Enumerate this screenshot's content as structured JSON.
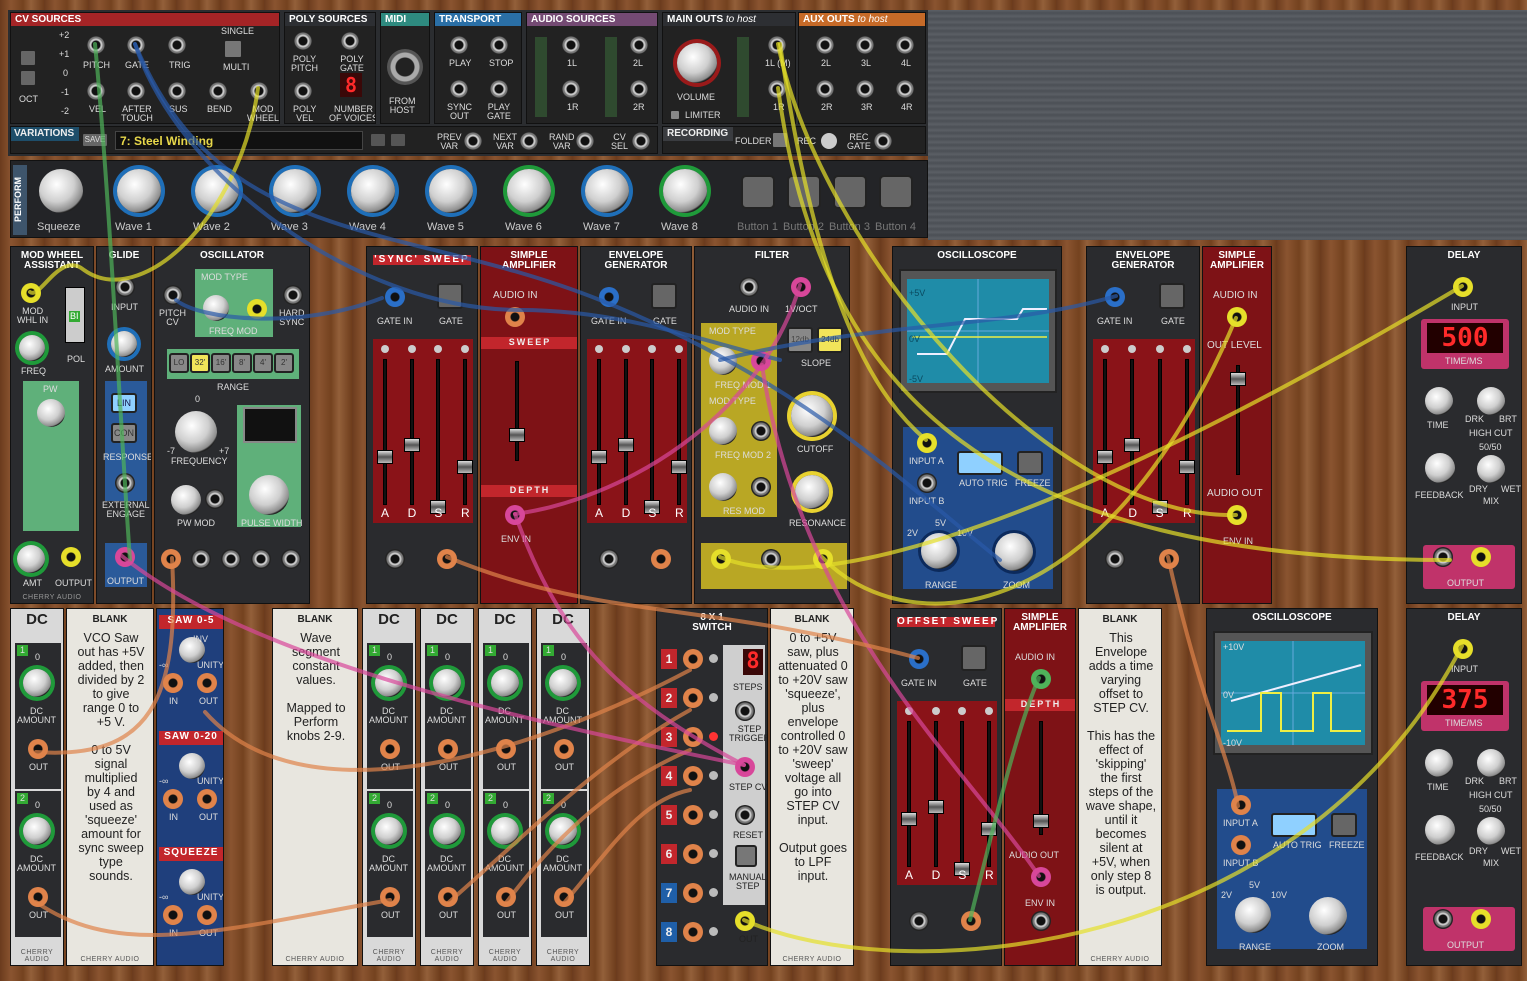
{
  "top": {
    "cv_sources": {
      "title": "CV SOURCES",
      "oct_values": [
        "+2",
        "+1",
        "0",
        "-1",
        "-2"
      ],
      "oct_label": "OCT",
      "pitch": "PITCH",
      "gate": "GATE",
      "trig": "TRIG",
      "vel": "VEL",
      "after_touch": "AFTER\nTOUCH",
      "sus": "SUS",
      "bend": "BEND",
      "mod_wheel": "MOD\nWHEEL",
      "single": "SINGLE",
      "multi": "MULTI"
    },
    "poly_sources": {
      "title": "POLY SOURCES",
      "poly_pitch": "POLY\nPITCH",
      "poly_gate": "POLY\nGATE",
      "poly_vel": "POLY\nVEL",
      "voices_label": "NUMBER\nOF VOICES",
      "voices": "8"
    },
    "midi": {
      "title": "MIDI",
      "from_host": "FROM\nHOST"
    },
    "transport": {
      "title": "TRANSPORT",
      "play": "PLAY",
      "stop": "STOP",
      "sync_out": "SYNC\nOUT",
      "play_gate": "PLAY\nGATE"
    },
    "audio_sources": {
      "title": "AUDIO SOURCES",
      "l1": "1L",
      "r1": "1R",
      "l2": "2L",
      "r2": "2R"
    },
    "main_outs": {
      "title": "MAIN OUTS",
      "to_host": "to host",
      "volume": "VOLUME",
      "limiter": "LIMITER",
      "l1m": "1L (M)",
      "r1": "1R"
    },
    "aux_outs": {
      "title": "AUX OUTS",
      "to_host": "to host",
      "jacks": [
        "2L",
        "3L",
        "4L",
        "2R",
        "3R",
        "4R"
      ]
    },
    "variations": {
      "title": "VARIATIONS",
      "save": "SAVE",
      "name": "7: Steel Winding",
      "prev": "PREV\nVAR",
      "next": "NEXT\nVAR",
      "rand": "RAND\nVAR",
      "cv_sel": "CV\nSEL"
    },
    "recording": {
      "title": "RECORDING",
      "folder": "FOLDER",
      "rec": "REC",
      "rec_gate": "REC\nGATE"
    },
    "perform": {
      "title": "PERFORM",
      "knobs": [
        "Squeeze",
        "Wave 1",
        "Wave 2",
        "Wave 3",
        "Wave 4",
        "Wave 5",
        "Wave 6",
        "Wave 7",
        "Wave 8"
      ],
      "buttons": [
        "Button 1",
        "Button 2",
        "Button 3",
        "Button 4"
      ]
    }
  },
  "row1": {
    "modwheel": {
      "title": "MOD WHEEL\nASSISTANT",
      "mod_whl_in": "MOD\nWHL IN",
      "freq": "FREQ",
      "pol": "POL",
      "bi": "BI",
      "pw": "PW",
      "amt": "AMT",
      "output": "OUTPUT"
    },
    "glide": {
      "title": "GLIDE",
      "input": "INPUT",
      "amount": "AMOUNT",
      "lin": "LIN",
      "con": "CON",
      "response": "RESPONSE",
      "ext": "EXTERNAL\nENGAGE",
      "output": "OUTPUT"
    },
    "osc": {
      "title": "OSCILLATOR",
      "pitch_cv": "PITCH\nCV",
      "mod_type": "MOD TYPE",
      "exp": "EXP",
      "freq_mod": "FREQ MOD",
      "hard_sync": "HARD\nSYNC",
      "ranges": [
        "LO",
        "32'",
        "16'",
        "8'",
        "4'",
        "2'"
      ],
      "range": "RANGE",
      "zero": "0",
      "m7": "-7",
      "p7": "+7",
      "frequency": "FREQUENCY",
      "pw_mod": "PW MOD",
      "pulse_width": "PULSE WIDTH"
    },
    "sync_sweep": {
      "title": "'SYNC' SWEEP",
      "gate_in": "GATE IN",
      "gate": "GATE",
      "adsr": [
        "A",
        "D",
        "S",
        "R"
      ]
    },
    "amp1": {
      "title": "SIMPLE\nAMPLIFIER",
      "audio_in": "AUDIO IN",
      "sweep": "SWEEP",
      "depth": "DEPTH",
      "env_in": "ENV IN"
    },
    "env1": {
      "title": "ENVELOPE\nGENERATOR",
      "gate_in": "GATE IN",
      "gate": "GATE",
      "adsr": [
        "A",
        "D",
        "S",
        "R"
      ]
    },
    "filter": {
      "title": "FILTER",
      "audio_in": "AUDIO IN",
      "vct": "1V/OCT",
      "mod_type": "MOD TYPE",
      "exp": "EXP",
      "freq_mod1": "FREQ MOD 1",
      "freq_mod2": "FREQ MOD 2",
      "res_mod": "RES MOD",
      "db12": "12db",
      "db24": "24db",
      "slope": "SLOPE",
      "cutoff": "CUTOFF",
      "resonance": "RESONANCE"
    },
    "scope1": {
      "title": "OSCILLOSCOPE",
      "p5": "+5V",
      "zero": "0V",
      "m5": "-5V",
      "input_a": "INPUT A",
      "input_b": "INPUT B",
      "auto_trig": "AUTO TRIG",
      "freeze": "FREEZE",
      "v2": "2V",
      "v5": "5V",
      "v10": "10V",
      "range": "RANGE",
      "zoom": "ZOOM"
    },
    "env2": {
      "title": "ENVELOPE\nGENERATOR",
      "gate_in": "GATE IN",
      "gate": "GATE",
      "adsr": [
        "A",
        "D",
        "S",
        "R"
      ]
    },
    "amp2": {
      "title": "SIMPLE\nAMPLIFIER",
      "audio_in": "AUDIO IN",
      "out_level": "OUT LEVEL",
      "audio_out": "AUDIO OUT",
      "env_in": "ENV IN"
    },
    "delay1": {
      "title": "DELAY",
      "input": "INPUT",
      "time_value": "500",
      "time_ms": "TIME/ms",
      "time": "TIME",
      "drk": "DRK",
      "brt": "BRT",
      "high_cut": "HIGH CUT",
      "feedback": "FEEDBACK",
      "ratio": "50/50",
      "dry": "DRY",
      "wet": "WET",
      "mix": "MIX",
      "output": "OUTPUT"
    }
  },
  "row2": {
    "dc1": {
      "title": "DC",
      "n1": "1",
      "n2": "2",
      "zero": "0",
      "dc_amount": "DC\nAMOUNT",
      "out": "OUT"
    },
    "blank1": {
      "title": "BLANK",
      "text": "VCO Saw\nout has +5V\nadded, then\ndivided by 2\nto give\nrange 0 to\n+5 V.\n\n0 to 5V\nsignal\nmultiplied\nby 4 and\nused as\n'squeeze'\namount for\nsync sweep\ntype\nsounds."
    },
    "atten": {
      "t1": "SAW 0-5",
      "t2": "SAW 0-20",
      "t3": "SQUEEZE",
      "inv": "INV",
      "unity": "UNITY",
      "minf": "-∞",
      "in": "IN",
      "out": "OUT"
    },
    "blank2": {
      "title": "BLANK",
      "text": "Wave\nsegment\nconstant\nvalues.\n\nMapped to\nPerform\nknobs 2-9."
    },
    "switch": {
      "title": "8 X 1\nSWITCH",
      "numbers": [
        "1",
        "2",
        "3",
        "4",
        "5",
        "6",
        "7",
        "8"
      ],
      "steps_value": "8",
      "steps": "STEPS",
      "step_trigger": "STEP\nTRIGGER",
      "step_cv": "STEP CV",
      "reset": "RESET",
      "manual_step": "MANUAL\nSTEP",
      "out": "OUT"
    },
    "blank3": {
      "title": "BLANK",
      "text": "0 to +5V\nsaw, plus\nattenuated 0\nto +20V saw\n'squeeze',\nplus\nenvelope\ncontrolled 0\nto +20V saw\n'sweep'\nvoltage all\ngo into\nSTEP CV\ninput.\n\nOutput goes\nto LPF\ninput."
    },
    "offset_sweep": {
      "title": "OFFSET SWEEP",
      "gate_in": "GATE IN",
      "gate": "GATE",
      "adsr": [
        "A",
        "D",
        "S",
        "R"
      ]
    },
    "amp3": {
      "title": "SIMPLE\nAMPLIFIER",
      "audio_in": "AUDIO IN",
      "depth": "DEPTH",
      "audio_out": "AUDIO OUT",
      "env_in": "ENV IN"
    },
    "blank4": {
      "title": "BLANK",
      "text": "This\nEnvelope\nadds a time\nvarying\noffset to\nSTEP CV.\n\nThis has the\neffect of\n'skipping'\nthe first\nsteps of the\nwave shape,\nuntil it\nbecomes\nsilent at\n+5V, when\nonly step 8\nis output."
    },
    "scope2": {
      "title": "OSCILLOSCOPE",
      "p10": "+10V",
      "zero": "0V",
      "m10": "-10V",
      "input_a": "INPUT A",
      "input_b": "INPUT B",
      "auto_trig": "AUTO TRIG",
      "freeze": "FREEZE",
      "v2": "2V",
      "v5": "5V",
      "v10": "10V",
      "range": "RANGE",
      "zoom": "ZOOM"
    },
    "delay2": {
      "title": "DELAY",
      "input": "INPUT",
      "time_value": "375",
      "time_ms": "TIME/ms",
      "time": "TIME",
      "drk": "DRK",
      "brt": "BRT",
      "high_cut": "HIGH CUT",
      "feedback": "FEEDBACK",
      "ratio": "50/50",
      "dry": "DRY",
      "wet": "WET",
      "mix": "MIX",
      "output": "OUTPUT"
    }
  },
  "brand": "CHERRY AUDIO",
  "colors": {
    "yellow": "#e6df2a",
    "blue": "#2a5aa8",
    "green": "#4fb35a",
    "orange": "#e0834a",
    "pink": "#d8479a",
    "red_panel": "#8a1318",
    "cyan_screen": "#1f8ca8"
  }
}
